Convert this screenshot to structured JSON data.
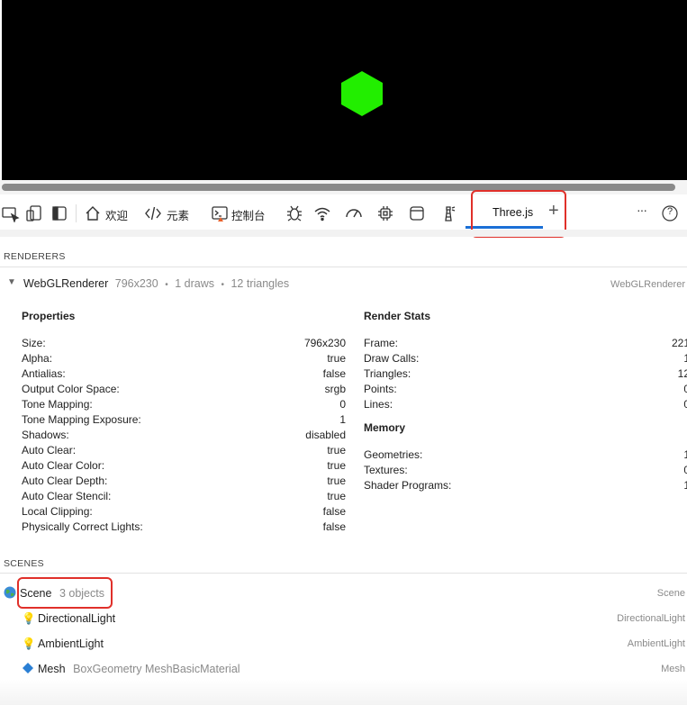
{
  "toolbar": {
    "tabs": [
      {
        "label": "欢迎",
        "icon": "home-icon"
      },
      {
        "label": "元素",
        "icon": "code-icon"
      },
      {
        "label": "控制台",
        "icon": "console-icon"
      }
    ],
    "active_tab": "Three.js",
    "add_tab_symbol": "+",
    "more_symbol": "···",
    "help_symbol": "?"
  },
  "renderers": {
    "header": "RENDERERS",
    "renderer": {
      "name": "WebGLRenderer",
      "size": "796x230",
      "draws": "1 draws",
      "triangles": "12 triangles",
      "type": "WebGLRenderer",
      "sep": "•"
    },
    "properties": {
      "title": "Properties",
      "rows": [
        {
          "k": "Size:",
          "v": "796x230"
        },
        {
          "k": "Alpha:",
          "v": "true"
        },
        {
          "k": "Antialias:",
          "v": "false"
        },
        {
          "k": "Output Color Space:",
          "v": "srgb"
        },
        {
          "k": "Tone Mapping:",
          "v": "0"
        },
        {
          "k": "Tone Mapping Exposure:",
          "v": "1"
        },
        {
          "k": "Shadows:",
          "v": "disabled"
        },
        {
          "k": "Auto Clear:",
          "v": "true"
        },
        {
          "k": "Auto Clear Color:",
          "v": "true"
        },
        {
          "k": "Auto Clear Depth:",
          "v": "true"
        },
        {
          "k": "Auto Clear Stencil:",
          "v": "true"
        },
        {
          "k": "Local Clipping:",
          "v": "false"
        },
        {
          "k": "Physically Correct Lights:",
          "v": "false"
        }
      ]
    },
    "render_stats": {
      "title": "Render Stats",
      "rows": [
        {
          "k": "Frame:",
          "v": "221"
        },
        {
          "k": "Draw Calls:",
          "v": "1"
        },
        {
          "k": "Triangles:",
          "v": "12"
        },
        {
          "k": "Points:",
          "v": "0"
        },
        {
          "k": "Lines:",
          "v": "0"
        }
      ]
    },
    "memory": {
      "title": "Memory",
      "rows": [
        {
          "k": "Geometries:",
          "v": "1"
        },
        {
          "k": "Textures:",
          "v": "0"
        },
        {
          "k": "Shader Programs:",
          "v": "1"
        }
      ]
    }
  },
  "scenes": {
    "header": "SCENES",
    "scene": {
      "name": "Scene",
      "count": "3 objects",
      "type": "Scene",
      "icon": "globe-icon"
    },
    "children": [
      {
        "name": "DirectionalLight",
        "detail": "",
        "type": "DirectionalLight",
        "icon": "lightbulb-icon"
      },
      {
        "name": "AmbientLight",
        "detail": "",
        "type": "AmbientLight",
        "icon": "lightbulb-icon"
      },
      {
        "name": "Mesh",
        "detail": "BoxGeometry MeshBasicMaterial",
        "type": "Mesh",
        "icon": "diamond-icon"
      }
    ]
  },
  "colors": {
    "accent": "#1a6fd6",
    "highlight": "#e0302a",
    "cube": "#22ee00"
  }
}
